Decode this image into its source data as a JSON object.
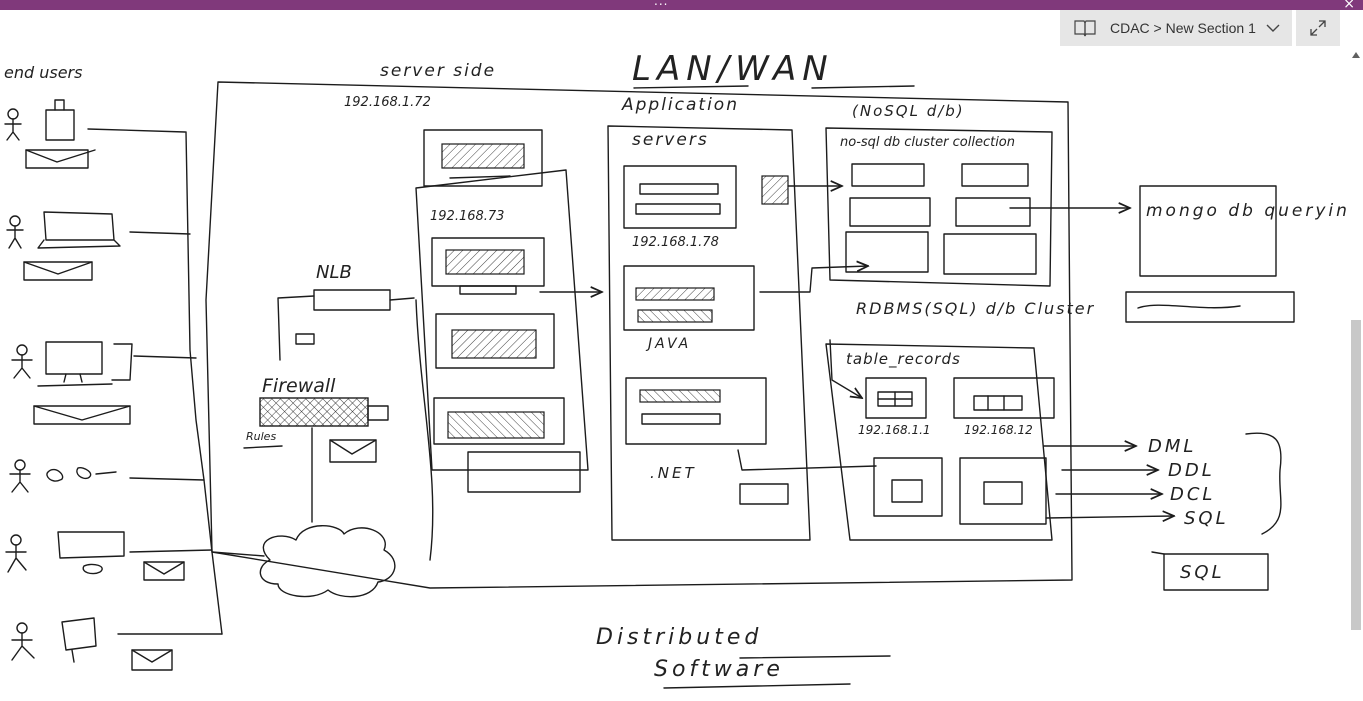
{
  "window": {
    "accent": "#80397b",
    "title_dots": "...",
    "close_glyph": "×"
  },
  "navigation": {
    "notebook": "CDAC",
    "separator": ">",
    "section": "New Section 1",
    "breadcrumb": "CDAC > New Section 1"
  },
  "sketch": {
    "title": "LAN/WAN",
    "end_users": "end users",
    "server_side": "server side",
    "server_ip": "192.168.1.72",
    "ip_73": "192.168.73",
    "nlb": "NLB",
    "firewall": "Firewall",
    "rules": "Rules",
    "application": "Application",
    "servers": "servers",
    "ip_78": "192.168.1.78",
    "java": "JAVA",
    "net": ".NET",
    "nosql_db": "(NoSQL d/b)",
    "nosql_cluster": "no-sql db cluster collection",
    "mongo": "mongo db querying",
    "rdbms": "RDBMS(SQL) d/b Cluster",
    "table_records": "table_records",
    "ip_11": "192.168.1.1",
    "ip_12": "192.168.12",
    "dml": "DML",
    "ddl": "DDL",
    "dcl": "DCL",
    "sql_cmd": "SQL",
    "sql_box": "SQL",
    "distributed": "Distributed",
    "software": "Software"
  }
}
